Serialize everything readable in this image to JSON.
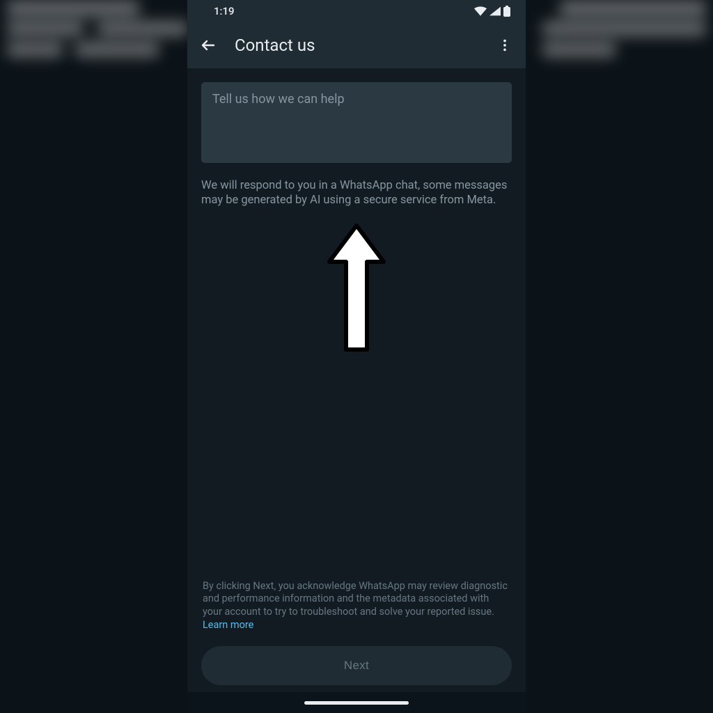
{
  "status": {
    "time": "1:19"
  },
  "header": {
    "title": "Contact us"
  },
  "help_input": {
    "placeholder": "Tell us how we can help",
    "value": ""
  },
  "info_text": "We will respond to you in a WhatsApp chat, some messages may be generated by AI using a secure service from Meta.",
  "disclaimer": {
    "text": "By clicking Next, you acknowledge WhatsApp may review diagnostic and performance information and the metadata associated with your account to try to troubleshoot and solve your reported issue. ",
    "link_label": "Learn more"
  },
  "next_button_label": "Next"
}
